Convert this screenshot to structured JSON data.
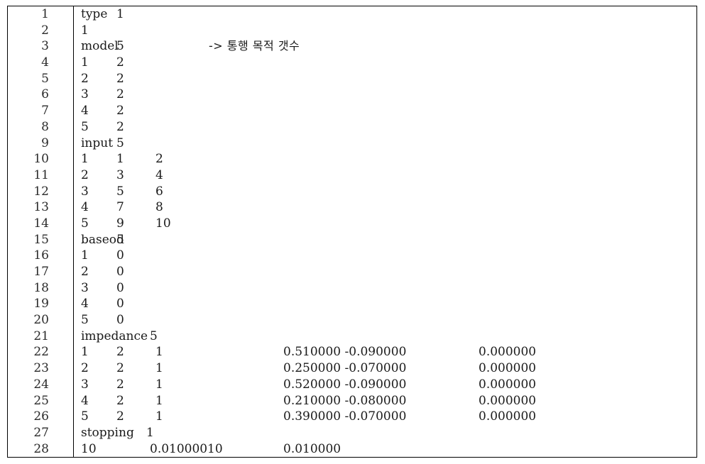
{
  "figure": {
    "kind": "source-code-listing",
    "border_color": "#000000",
    "background_color": "#ffffff",
    "text_color": "#1a1a1a",
    "total_lines": 28,
    "gutter_separator": true
  },
  "lines": [
    {
      "n": "1",
      "c1": "type",
      "c2": "1",
      "c3": "",
      "c4": "",
      "c5": "",
      "comment": ""
    },
    {
      "n": "2",
      "c1": "1",
      "c2": "",
      "c3": "",
      "c4": "",
      "c5": "",
      "comment": ""
    },
    {
      "n": "3",
      "c1": "model",
      "c2": "5",
      "c3": "",
      "c4": "",
      "c5": "",
      "comment": "-> 통행 목적 갯수"
    },
    {
      "n": "4",
      "c1": "1",
      "c2": "2",
      "c3": "",
      "c4": "",
      "c5": "",
      "comment": ""
    },
    {
      "n": "5",
      "c1": "2",
      "c2": "2",
      "c3": "",
      "c4": "",
      "c5": "",
      "comment": ""
    },
    {
      "n": "6",
      "c1": "3",
      "c2": "2",
      "c3": "",
      "c4": "",
      "c5": "",
      "comment": ""
    },
    {
      "n": "7",
      "c1": "4",
      "c2": "2",
      "c3": "",
      "c4": "",
      "c5": "",
      "comment": ""
    },
    {
      "n": "8",
      "c1": "5",
      "c2": "2",
      "c3": "",
      "c4": "",
      "c5": "",
      "comment": ""
    },
    {
      "n": "9",
      "c1": "input",
      "c2": "5",
      "c3": "",
      "c4": "",
      "c5": "",
      "comment": ""
    },
    {
      "n": "10",
      "c1": "1",
      "c2": "1",
      "c3": "2",
      "c4": "",
      "c5": "",
      "comment": ""
    },
    {
      "n": "11",
      "c1": "2",
      "c2": "3",
      "c3": "4",
      "c4": "",
      "c5": "",
      "comment": ""
    },
    {
      "n": "12",
      "c1": "3",
      "c2": "5",
      "c3": "6",
      "c4": "",
      "c5": "",
      "comment": ""
    },
    {
      "n": "13",
      "c1": "4",
      "c2": "7",
      "c3": "8",
      "c4": "",
      "c5": "",
      "comment": ""
    },
    {
      "n": "14",
      "c1": "5",
      "c2": "9",
      "c3": "10",
      "c4": "",
      "c5": "",
      "comment": ""
    },
    {
      "n": "15",
      "c1": "baseod",
      "c2": "5",
      "c3": "",
      "c4": "",
      "c5": "",
      "comment": ""
    },
    {
      "n": "16",
      "c1": "1",
      "c2": "0",
      "c3": "",
      "c4": "",
      "c5": "",
      "comment": ""
    },
    {
      "n": "17",
      "c1": "2",
      "c2": "0",
      "c3": "",
      "c4": "",
      "c5": "",
      "comment": ""
    },
    {
      "n": "18",
      "c1": "3",
      "c2": "0",
      "c3": "",
      "c4": "",
      "c5": "",
      "comment": ""
    },
    {
      "n": "19",
      "c1": "4",
      "c2": "0",
      "c3": "",
      "c4": "",
      "c5": "",
      "comment": ""
    },
    {
      "n": "20",
      "c1": "5",
      "c2": "0",
      "c3": "",
      "c4": "",
      "c5": "",
      "comment": ""
    },
    {
      "n": "21",
      "c1": "impedance",
      "c2": "",
      "c3": "5",
      "c4": "",
      "c5": "",
      "comment": ""
    },
    {
      "n": "22",
      "c1": "1",
      "c2": "2",
      "c3": "1",
      "c4": "0.510000 -0.090000",
      "c5": "0.000000",
      "comment": ""
    },
    {
      "n": "23",
      "c1": "2",
      "c2": "2",
      "c3": "1",
      "c4": "0.250000 -0.070000",
      "c5": "0.000000",
      "comment": ""
    },
    {
      "n": "24",
      "c1": "3",
      "c2": "2",
      "c3": "1",
      "c4": "0.520000 -0.090000",
      "c5": "0.000000",
      "comment": ""
    },
    {
      "n": "25",
      "c1": "4",
      "c2": "2",
      "c3": "1",
      "c4": "0.210000 -0.080000",
      "c5": "0.000000",
      "comment": ""
    },
    {
      "n": "26",
      "c1": "5",
      "c2": "2",
      "c3": "1",
      "c4": "0.390000 -0.070000",
      "c5": "0.000000",
      "comment": ""
    },
    {
      "n": "27",
      "c1": "stopping",
      "c2": "1",
      "c3": "",
      "c4": "",
      "c5": "",
      "comment": ""
    },
    {
      "n": "28",
      "c1": "10",
      "c2": "0.010000",
      "c3": "10",
      "c4": "0.010000",
      "c5": "",
      "comment": ""
    }
  ]
}
